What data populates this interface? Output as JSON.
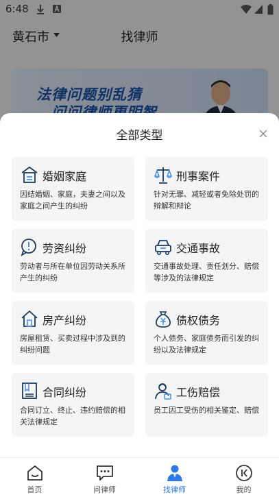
{
  "status_bar": {
    "time": "6:48"
  },
  "header": {
    "city": "黄石市",
    "title": "找律师"
  },
  "banner": {
    "line1": "法律问题别乱猜",
    "line2": "问问律师更明智"
  },
  "sheet": {
    "title": "全部类型",
    "categories": [
      {
        "title": "婚姻家庭",
        "icon": "family-home-icon",
        "desc": "因结婚姻、家庭，夫妻之间以及家庭之间产生的纠纷"
      },
      {
        "title": "刑事案件",
        "icon": "scales-icon",
        "desc": "针对无罪、减轻或者免除处罚的辩解和辩论"
      },
      {
        "title": "劳资纠纷",
        "icon": "chat-warning-icon",
        "desc": "劳动者与所在单位因劳动关系所产生的纠纷"
      },
      {
        "title": "交通事故",
        "icon": "car-icon",
        "desc": "交通事故处理、责任划分、赔偿等涉及的法律规定"
      },
      {
        "title": "房产纠纷",
        "icon": "house-icon",
        "desc": "房屋租赁、买卖过程中涉及到的纠纷问题"
      },
      {
        "title": "债权债务",
        "icon": "money-bag-icon",
        "desc": "个人债务、家庭债务而引发的纠纷以及法律规定"
      },
      {
        "title": "合同纠纷",
        "icon": "contract-book-icon",
        "desc": "合同订立、终止、违约赔偿的相关法律规定"
      },
      {
        "title": "工伤赔偿",
        "icon": "injured-worker-icon",
        "desc": "员工因工受伤的相关鉴定、赔偿"
      }
    ]
  },
  "bottom_nav": {
    "items": [
      {
        "label": "首页",
        "icon": "home-icon"
      },
      {
        "label": "问律师",
        "icon": "chat-icon"
      },
      {
        "label": "找律师",
        "icon": "lawyer-icon"
      },
      {
        "label": "我的",
        "icon": "profile-icon"
      }
    ],
    "active": "找律师"
  },
  "colors": {
    "accent": "#2c7be5",
    "card_bg": "#f5f5f5",
    "icon_stroke": "#1c3a5e"
  }
}
